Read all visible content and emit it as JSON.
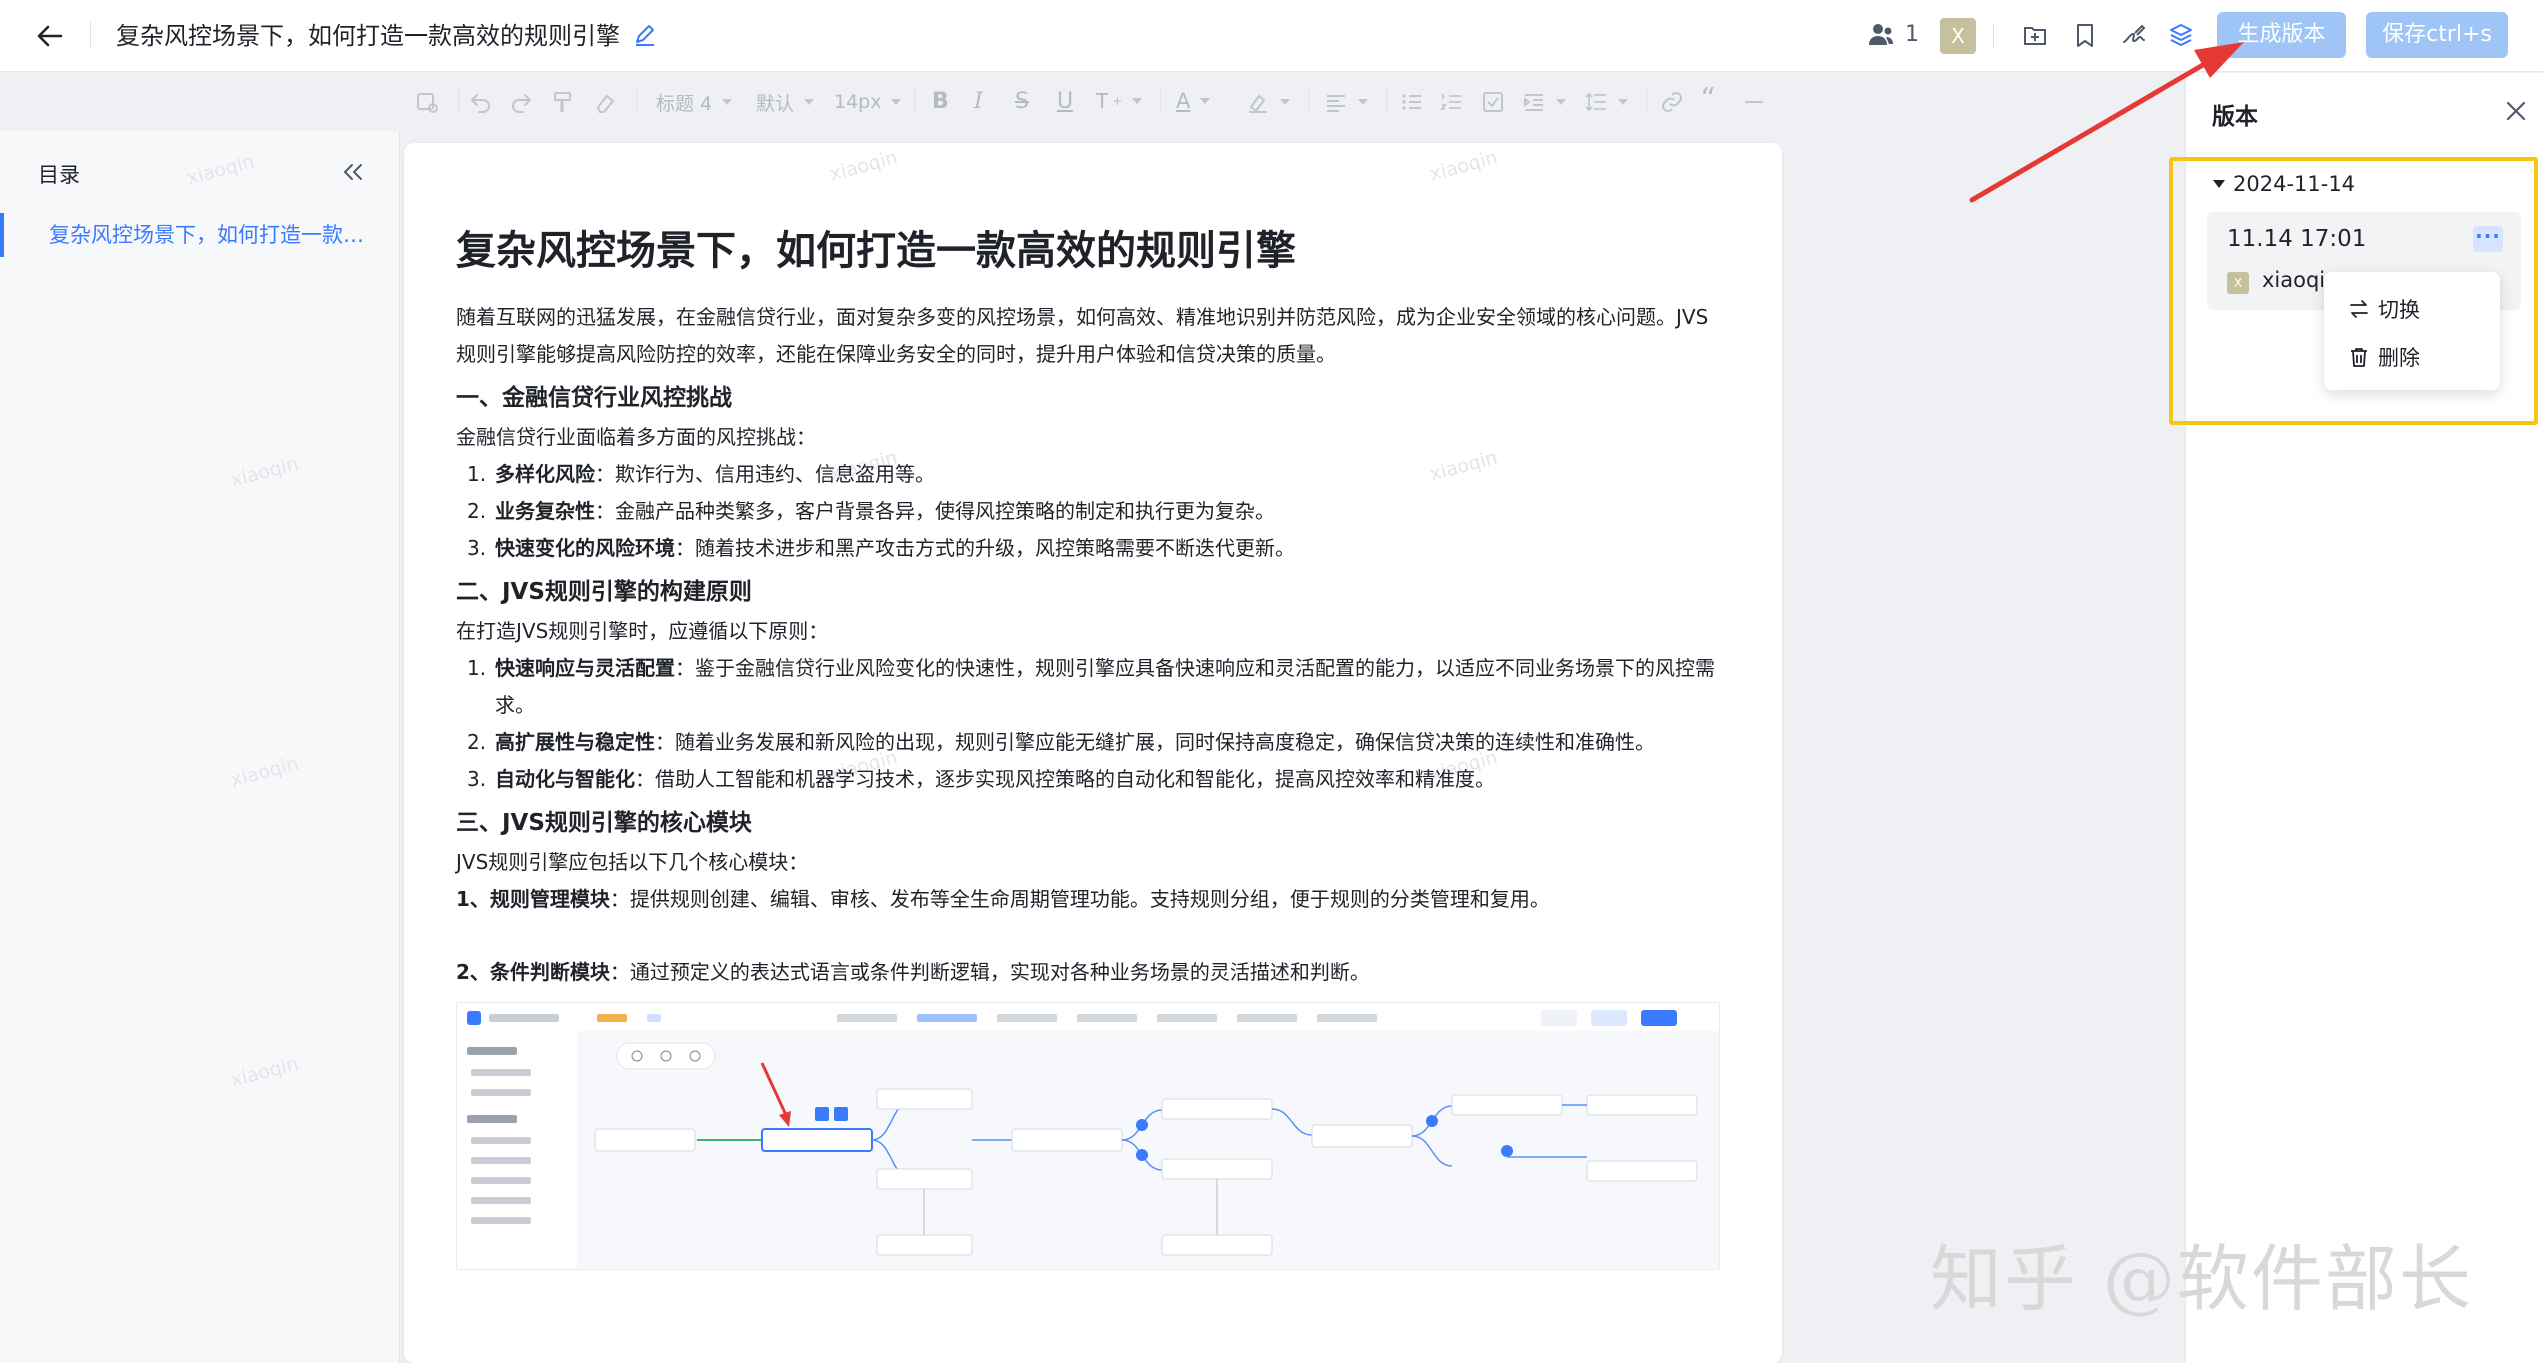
{
  "header": {
    "title": "复杂风控场景下，如何打造一款高效的规则引擎",
    "collaborator_count": "1",
    "avatar_letter": "X",
    "generate_version_label": "生成版本",
    "save_label": "保存ctrl+s"
  },
  "toolbar": {
    "heading_select": "标题 4",
    "font_select": "默认",
    "size_select": "14px"
  },
  "toc": {
    "title": "目录",
    "items": [
      {
        "label": "复杂风控场景下，如何打造一款…"
      }
    ]
  },
  "watermark": "xiaoqin",
  "doc": {
    "title": "复杂风控场景下，如何打造一款高效的规则引擎",
    "intro": "随着互联网的迅猛发展，在金融信贷行业，面对复杂多变的风控场景，如何高效、精准地识别并防范风险，成为企业安全领域的核心问题。JVS规则引擎能够提高风险防控的效率，还能在保障业务安全的同时，提升用户体验和信贷决策的质量。",
    "s1_title": "一、金融信贷行业风控挑战",
    "s1_intro": "金融信贷行业面临着多方面的风控挑战：",
    "s1_items": [
      {
        "num": "1.",
        "term": "多样化风险",
        "text": "：欺诈行为、信用违约、信息盗用等。"
      },
      {
        "num": "2.",
        "term": "业务复杂性",
        "text": "：金融产品种类繁多，客户背景各异，使得风控策略的制定和执行更为复杂。"
      },
      {
        "num": "3.",
        "term": "快速变化的风险环境",
        "text": "：随着技术进步和黑产攻击方式的升级，风控策略需要不断迭代更新。"
      }
    ],
    "s2_title": "二、JVS规则引擎的构建原则",
    "s2_intro": "在打造JVS规则引擎时，应遵循以下原则：",
    "s2_items": [
      {
        "num": "1.",
        "term": "快速响应与灵活配置",
        "text": "：鉴于金融信贷行业风险变化的快速性，规则引擎应具备快速响应和灵活配置的能力，以适应不同业务场景下的风控需求。"
      },
      {
        "num": "2.",
        "term": "高扩展性与稳定性",
        "text": "：随着业务发展和新风险的出现，规则引擎应能无缝扩展，同时保持高度稳定，确保信贷决策的连续性和准确性。"
      },
      {
        "num": "3.",
        "term": "自动化与智能化",
        "text": "：借助人工智能和机器学习技术，逐步实现风控策略的自动化和智能化，提高风控效率和精准度。"
      }
    ],
    "s3_title": "三、JVS规则引擎的核心模块",
    "s3_intro": "JVS规则引擎应包括以下几个核心模块：",
    "m1_term": "1、规则管理模块",
    "m1_text": "：提供规则创建、编辑、审核、发布等全生命周期管理功能。支持规则分组，便于规则的分类管理和复用。",
    "m2_term": "2、条件判断模块",
    "m2_text": "：通过预定义的表达式语言或条件判断逻辑，实现对各种业务场景的灵活描述和判断。"
  },
  "version_panel": {
    "title": "版本",
    "group_date": "2024-11-14",
    "entry_time": "11.14 17:01",
    "entry_user_letter": "X",
    "entry_user": "xiaoqi",
    "menu_switch": "切换",
    "menu_delete": "删除"
  },
  "overlay_text": "知乎 @软件部长",
  "colors": {
    "accent": "#3a7afe",
    "button_disabled": "#9fc4f6",
    "highlight_box": "#f5c518",
    "arrow": "#e53935"
  }
}
